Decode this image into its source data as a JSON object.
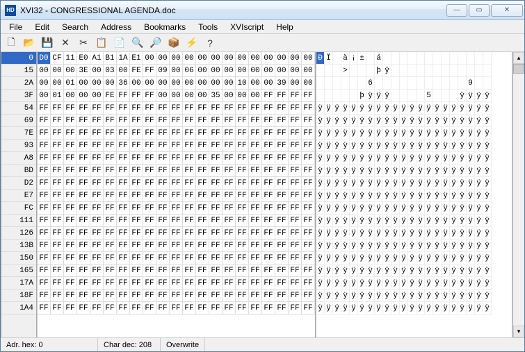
{
  "title": "XVI32 - CONGRESSIONAL AGENDA.doc",
  "menus": [
    "File",
    "Edit",
    "Search",
    "Address",
    "Bookmarks",
    "Tools",
    "XVIscript",
    "Help"
  ],
  "toolbar_icons": [
    "new-icon",
    "open-icon",
    "save-icon",
    "delete-icon",
    "cut-icon",
    "copy-icon",
    "paste-icon",
    "find-icon",
    "replace-icon",
    "block-icon",
    "script-icon",
    "help-icon"
  ],
  "addresses": [
    "0",
    "15",
    "2A",
    "3F",
    "54",
    "69",
    "7E",
    "93",
    "A8",
    "BD",
    "D2",
    "E7",
    "FC",
    "111",
    "126",
    "13B",
    "150",
    "165",
    "17A",
    "18F",
    "1A4"
  ],
  "hex_rows": [
    [
      "D0",
      "CF",
      "11",
      "E0",
      "A1",
      "B1",
      "1A",
      "E1",
      "00",
      "00",
      "00",
      "00",
      "00",
      "00",
      "00",
      "00",
      "00",
      "00",
      "00",
      "00",
      "00"
    ],
    [
      "00",
      "00",
      "00",
      "3E",
      "00",
      "03",
      "00",
      "FE",
      "FF",
      "09",
      "00",
      "06",
      "00",
      "00",
      "00",
      "00",
      "00",
      "00",
      "00",
      "00",
      "00"
    ],
    [
      "00",
      "00",
      "01",
      "00",
      "00",
      "00",
      "36",
      "00",
      "00",
      "00",
      "00",
      "00",
      "00",
      "00",
      "00",
      "10",
      "00",
      "00",
      "39",
      "00",
      "00"
    ],
    [
      "00",
      "01",
      "00",
      "00",
      "00",
      "FE",
      "FF",
      "FF",
      "FF",
      "00",
      "00",
      "00",
      "00",
      "35",
      "00",
      "00",
      "00",
      "FF",
      "FF",
      "FF",
      "FF"
    ],
    [
      "FF",
      "FF",
      "FF",
      "FF",
      "FF",
      "FF",
      "FF",
      "FF",
      "FF",
      "FF",
      "FF",
      "FF",
      "FF",
      "FF",
      "FF",
      "FF",
      "FF",
      "FF",
      "FF",
      "FF",
      "FF"
    ],
    [
      "FF",
      "FF",
      "FF",
      "FF",
      "FF",
      "FF",
      "FF",
      "FF",
      "FF",
      "FF",
      "FF",
      "FF",
      "FF",
      "FF",
      "FF",
      "FF",
      "FF",
      "FF",
      "FF",
      "FF",
      "FF"
    ],
    [
      "FF",
      "FF",
      "FF",
      "FF",
      "FF",
      "FF",
      "FF",
      "FF",
      "FF",
      "FF",
      "FF",
      "FF",
      "FF",
      "FF",
      "FF",
      "FF",
      "FF",
      "FF",
      "FF",
      "FF",
      "FF"
    ],
    [
      "FF",
      "FF",
      "FF",
      "FF",
      "FF",
      "FF",
      "FF",
      "FF",
      "FF",
      "FF",
      "FF",
      "FF",
      "FF",
      "FF",
      "FF",
      "FF",
      "FF",
      "FF",
      "FF",
      "FF",
      "FF"
    ],
    [
      "FF",
      "FF",
      "FF",
      "FF",
      "FF",
      "FF",
      "FF",
      "FF",
      "FF",
      "FF",
      "FF",
      "FF",
      "FF",
      "FF",
      "FF",
      "FF",
      "FF",
      "FF",
      "FF",
      "FF",
      "FF"
    ],
    [
      "FF",
      "FF",
      "FF",
      "FF",
      "FF",
      "FF",
      "FF",
      "FF",
      "FF",
      "FF",
      "FF",
      "FF",
      "FF",
      "FF",
      "FF",
      "FF",
      "FF",
      "FF",
      "FF",
      "FF",
      "FF"
    ],
    [
      "FF",
      "FF",
      "FF",
      "FF",
      "FF",
      "FF",
      "FF",
      "FF",
      "FF",
      "FF",
      "FF",
      "FF",
      "FF",
      "FF",
      "FF",
      "FF",
      "FF",
      "FF",
      "FF",
      "FF",
      "FF"
    ],
    [
      "FF",
      "FF",
      "FF",
      "FF",
      "FF",
      "FF",
      "FF",
      "FF",
      "FF",
      "FF",
      "FF",
      "FF",
      "FF",
      "FF",
      "FF",
      "FF",
      "FF",
      "FF",
      "FF",
      "FF",
      "FF"
    ],
    [
      "FF",
      "FF",
      "FF",
      "FF",
      "FF",
      "FF",
      "FF",
      "FF",
      "FF",
      "FF",
      "FF",
      "FF",
      "FF",
      "FF",
      "FF",
      "FF",
      "FF",
      "FF",
      "FF",
      "FF",
      "FF"
    ],
    [
      "FF",
      "FF",
      "FF",
      "FF",
      "FF",
      "FF",
      "FF",
      "FF",
      "FF",
      "FF",
      "FF",
      "FF",
      "FF",
      "FF",
      "FF",
      "FF",
      "FF",
      "FF",
      "FF",
      "FF",
      "FF"
    ],
    [
      "FF",
      "FF",
      "FF",
      "FF",
      "FF",
      "FF",
      "FF",
      "FF",
      "FF",
      "FF",
      "FF",
      "FF",
      "FF",
      "FF",
      "FF",
      "FF",
      "FF",
      "FF",
      "FF",
      "FF",
      "FF"
    ],
    [
      "FF",
      "FF",
      "FF",
      "FF",
      "FF",
      "FF",
      "FF",
      "FF",
      "FF",
      "FF",
      "FF",
      "FF",
      "FF",
      "FF",
      "FF",
      "FF",
      "FF",
      "FF",
      "FF",
      "FF",
      "FF"
    ],
    [
      "FF",
      "FF",
      "FF",
      "FF",
      "FF",
      "FF",
      "FF",
      "FF",
      "FF",
      "FF",
      "FF",
      "FF",
      "FF",
      "FF",
      "FF",
      "FF",
      "FF",
      "FF",
      "FF",
      "FF",
      "FF"
    ],
    [
      "FF",
      "FF",
      "FF",
      "FF",
      "FF",
      "FF",
      "FF",
      "FF",
      "FF",
      "FF",
      "FF",
      "FF",
      "FF",
      "FF",
      "FF",
      "FF",
      "FF",
      "FF",
      "FF",
      "FF",
      "FF"
    ],
    [
      "FF",
      "FF",
      "FF",
      "FF",
      "FF",
      "FF",
      "FF",
      "FF",
      "FF",
      "FF",
      "FF",
      "FF",
      "FF",
      "FF",
      "FF",
      "FF",
      "FF",
      "FF",
      "FF",
      "FF",
      "FF"
    ],
    [
      "FF",
      "FF",
      "FF",
      "FF",
      "FF",
      "FF",
      "FF",
      "FF",
      "FF",
      "FF",
      "FF",
      "FF",
      "FF",
      "FF",
      "FF",
      "FF",
      "FF",
      "FF",
      "FF",
      "FF",
      "FF"
    ],
    [
      "FF",
      "FF",
      "FF",
      "FF",
      "FF",
      "FF",
      "FF",
      "FF",
      "FF",
      "FF",
      "FF",
      "FF",
      "FF",
      "FF",
      "FF",
      "FF",
      "FF",
      "FF",
      "FF",
      "FF",
      "FF"
    ]
  ],
  "char_rows": [
    [
      "Ð",
      "Ï",
      " ",
      "à",
      "¡",
      "±",
      " ",
      "á",
      " ",
      " ",
      " ",
      " ",
      " ",
      " ",
      " ",
      " ",
      " ",
      " ",
      " ",
      " ",
      " "
    ],
    [
      " ",
      " ",
      " ",
      ">",
      " ",
      " ",
      " ",
      "þ",
      "ÿ",
      " ",
      " ",
      " ",
      " ",
      " ",
      " ",
      " ",
      " ",
      " ",
      " ",
      " ",
      " "
    ],
    [
      " ",
      " ",
      " ",
      " ",
      " ",
      " ",
      "6",
      " ",
      " ",
      " ",
      " ",
      " ",
      " ",
      " ",
      " ",
      " ",
      " ",
      " ",
      "9",
      " ",
      " "
    ],
    [
      " ",
      " ",
      " ",
      " ",
      " ",
      "þ",
      "ÿ",
      "ÿ",
      "ÿ",
      " ",
      " ",
      " ",
      " ",
      "5",
      " ",
      " ",
      " ",
      "ÿ",
      "ÿ",
      "ÿ",
      "ÿ"
    ],
    [
      "ÿ",
      "ÿ",
      "ÿ",
      "ÿ",
      "ÿ",
      "ÿ",
      "ÿ",
      "ÿ",
      "ÿ",
      "ÿ",
      "ÿ",
      "ÿ",
      "ÿ",
      "ÿ",
      "ÿ",
      "ÿ",
      "ÿ",
      "ÿ",
      "ÿ",
      "ÿ",
      "ÿ"
    ],
    [
      "ÿ",
      "ÿ",
      "ÿ",
      "ÿ",
      "ÿ",
      "ÿ",
      "ÿ",
      "ÿ",
      "ÿ",
      "ÿ",
      "ÿ",
      "ÿ",
      "ÿ",
      "ÿ",
      "ÿ",
      "ÿ",
      "ÿ",
      "ÿ",
      "ÿ",
      "ÿ",
      "ÿ"
    ],
    [
      "ÿ",
      "ÿ",
      "ÿ",
      "ÿ",
      "ÿ",
      "ÿ",
      "ÿ",
      "ÿ",
      "ÿ",
      "ÿ",
      "ÿ",
      "ÿ",
      "ÿ",
      "ÿ",
      "ÿ",
      "ÿ",
      "ÿ",
      "ÿ",
      "ÿ",
      "ÿ",
      "ÿ"
    ],
    [
      "ÿ",
      "ÿ",
      "ÿ",
      "ÿ",
      "ÿ",
      "ÿ",
      "ÿ",
      "ÿ",
      "ÿ",
      "ÿ",
      "ÿ",
      "ÿ",
      "ÿ",
      "ÿ",
      "ÿ",
      "ÿ",
      "ÿ",
      "ÿ",
      "ÿ",
      "ÿ",
      "ÿ"
    ],
    [
      "ÿ",
      "ÿ",
      "ÿ",
      "ÿ",
      "ÿ",
      "ÿ",
      "ÿ",
      "ÿ",
      "ÿ",
      "ÿ",
      "ÿ",
      "ÿ",
      "ÿ",
      "ÿ",
      "ÿ",
      "ÿ",
      "ÿ",
      "ÿ",
      "ÿ",
      "ÿ",
      "ÿ"
    ],
    [
      "ÿ",
      "ÿ",
      "ÿ",
      "ÿ",
      "ÿ",
      "ÿ",
      "ÿ",
      "ÿ",
      "ÿ",
      "ÿ",
      "ÿ",
      "ÿ",
      "ÿ",
      "ÿ",
      "ÿ",
      "ÿ",
      "ÿ",
      "ÿ",
      "ÿ",
      "ÿ",
      "ÿ"
    ],
    [
      "ÿ",
      "ÿ",
      "ÿ",
      "ÿ",
      "ÿ",
      "ÿ",
      "ÿ",
      "ÿ",
      "ÿ",
      "ÿ",
      "ÿ",
      "ÿ",
      "ÿ",
      "ÿ",
      "ÿ",
      "ÿ",
      "ÿ",
      "ÿ",
      "ÿ",
      "ÿ",
      "ÿ"
    ],
    [
      "ÿ",
      "ÿ",
      "ÿ",
      "ÿ",
      "ÿ",
      "ÿ",
      "ÿ",
      "ÿ",
      "ÿ",
      "ÿ",
      "ÿ",
      "ÿ",
      "ÿ",
      "ÿ",
      "ÿ",
      "ÿ",
      "ÿ",
      "ÿ",
      "ÿ",
      "ÿ",
      "ÿ"
    ],
    [
      "ÿ",
      "ÿ",
      "ÿ",
      "ÿ",
      "ÿ",
      "ÿ",
      "ÿ",
      "ÿ",
      "ÿ",
      "ÿ",
      "ÿ",
      "ÿ",
      "ÿ",
      "ÿ",
      "ÿ",
      "ÿ",
      "ÿ",
      "ÿ",
      "ÿ",
      "ÿ",
      "ÿ"
    ],
    [
      "ÿ",
      "ÿ",
      "ÿ",
      "ÿ",
      "ÿ",
      "ÿ",
      "ÿ",
      "ÿ",
      "ÿ",
      "ÿ",
      "ÿ",
      "ÿ",
      "ÿ",
      "ÿ",
      "ÿ",
      "ÿ",
      "ÿ",
      "ÿ",
      "ÿ",
      "ÿ",
      "ÿ"
    ],
    [
      "ÿ",
      "ÿ",
      "ÿ",
      "ÿ",
      "ÿ",
      "ÿ",
      "ÿ",
      "ÿ",
      "ÿ",
      "ÿ",
      "ÿ",
      "ÿ",
      "ÿ",
      "ÿ",
      "ÿ",
      "ÿ",
      "ÿ",
      "ÿ",
      "ÿ",
      "ÿ",
      "ÿ"
    ],
    [
      "ÿ",
      "ÿ",
      "ÿ",
      "ÿ",
      "ÿ",
      "ÿ",
      "ÿ",
      "ÿ",
      "ÿ",
      "ÿ",
      "ÿ",
      "ÿ",
      "ÿ",
      "ÿ",
      "ÿ",
      "ÿ",
      "ÿ",
      "ÿ",
      "ÿ",
      "ÿ",
      "ÿ"
    ],
    [
      "ÿ",
      "ÿ",
      "ÿ",
      "ÿ",
      "ÿ",
      "ÿ",
      "ÿ",
      "ÿ",
      "ÿ",
      "ÿ",
      "ÿ",
      "ÿ",
      "ÿ",
      "ÿ",
      "ÿ",
      "ÿ",
      "ÿ",
      "ÿ",
      "ÿ",
      "ÿ",
      "ÿ"
    ],
    [
      "ÿ",
      "ÿ",
      "ÿ",
      "ÿ",
      "ÿ",
      "ÿ",
      "ÿ",
      "ÿ",
      "ÿ",
      "ÿ",
      "ÿ",
      "ÿ",
      "ÿ",
      "ÿ",
      "ÿ",
      "ÿ",
      "ÿ",
      "ÿ",
      "ÿ",
      "ÿ",
      "ÿ"
    ],
    [
      "ÿ",
      "ÿ",
      "ÿ",
      "ÿ",
      "ÿ",
      "ÿ",
      "ÿ",
      "ÿ",
      "ÿ",
      "ÿ",
      "ÿ",
      "ÿ",
      "ÿ",
      "ÿ",
      "ÿ",
      "ÿ",
      "ÿ",
      "ÿ",
      "ÿ",
      "ÿ",
      "ÿ"
    ],
    [
      "ÿ",
      "ÿ",
      "ÿ",
      "ÿ",
      "ÿ",
      "ÿ",
      "ÿ",
      "ÿ",
      "ÿ",
      "ÿ",
      "ÿ",
      "ÿ",
      "ÿ",
      "ÿ",
      "ÿ",
      "ÿ",
      "ÿ",
      "ÿ",
      "ÿ",
      "ÿ",
      "ÿ"
    ],
    [
      "ÿ",
      "ÿ",
      "ÿ",
      "ÿ",
      "ÿ",
      "ÿ",
      "ÿ",
      "ÿ",
      "ÿ",
      "ÿ",
      "ÿ",
      "ÿ",
      "ÿ",
      "ÿ",
      "ÿ",
      "ÿ",
      "ÿ",
      "ÿ",
      "ÿ",
      "ÿ",
      "ÿ"
    ]
  ],
  "status": {
    "addr": "Adr. hex: 0",
    "chardec": "Char dec: 208",
    "mode": "Overwrite"
  },
  "toolbar_glyphs": {
    "new-icon": "🗋",
    "open-icon": "📂",
    "save-icon": "💾",
    "delete-icon": "✕",
    "cut-icon": "✂",
    "copy-icon": "📋",
    "paste-icon": "📄",
    "find-icon": "🔍",
    "replace-icon": "🔎",
    "block-icon": "📦",
    "script-icon": "⚡",
    "help-icon": "?"
  }
}
